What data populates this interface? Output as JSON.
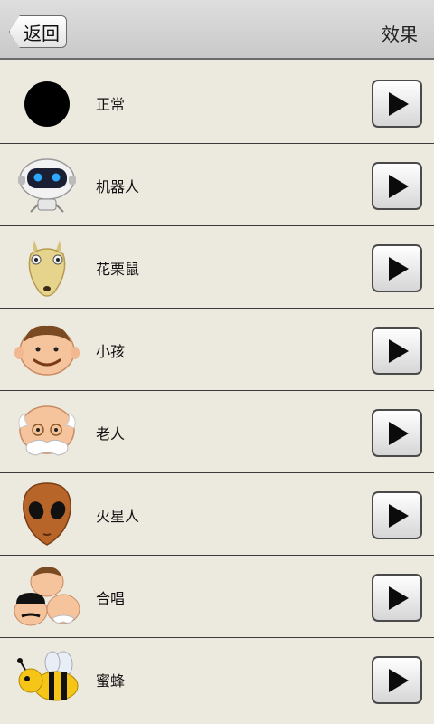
{
  "header": {
    "back_label": "返回",
    "title": "效果"
  },
  "effects": [
    {
      "label": "正常",
      "icon": "black-circle-icon"
    },
    {
      "label": "机器人",
      "icon": "robot-icon"
    },
    {
      "label": "花栗鼠",
      "icon": "chipmunk-icon"
    },
    {
      "label": "小孩",
      "icon": "child-face-icon"
    },
    {
      "label": "老人",
      "icon": "old-man-face-icon"
    },
    {
      "label": "火星人",
      "icon": "martian-icon"
    },
    {
      "label": "合唱",
      "icon": "chorus-faces-icon"
    },
    {
      "label": "蜜蜂",
      "icon": "bee-icon"
    }
  ]
}
